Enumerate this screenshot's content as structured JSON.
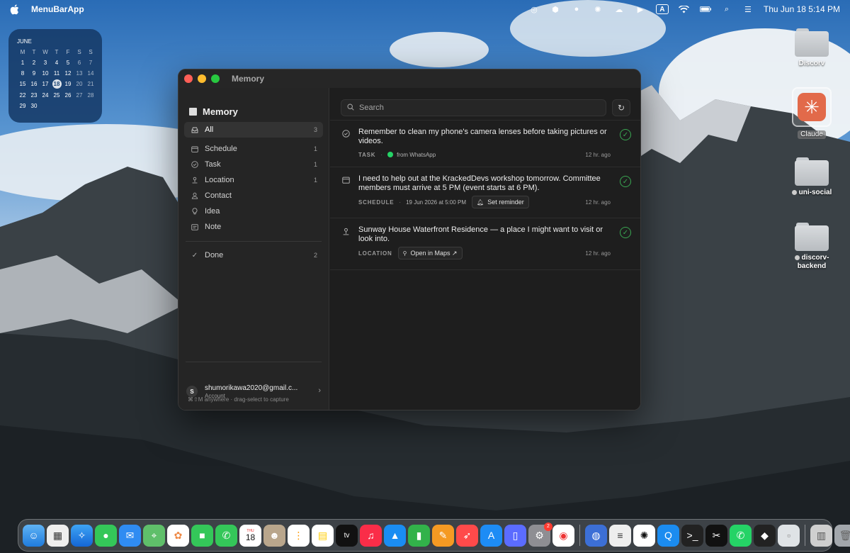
{
  "menubar": {
    "app_name": "MenuBarApp",
    "input_badge": "A",
    "datetime": "Thu Jun 18  5:14 PM"
  },
  "calendar_widget": {
    "month": "JUNE",
    "weekdays": [
      "M",
      "T",
      "W",
      "T",
      "F",
      "S",
      "S"
    ],
    "weeks": [
      [
        "1",
        "2",
        "3",
        "4",
        "5",
        "6",
        "7"
      ],
      [
        "8",
        "9",
        "10",
        "11",
        "12",
        "13",
        "14"
      ],
      [
        "15",
        "16",
        "17",
        "18",
        "19",
        "20",
        "21"
      ],
      [
        "22",
        "23",
        "24",
        "25",
        "26",
        "27",
        "28"
      ],
      [
        "29",
        "30",
        "",
        "",
        "",
        "",
        ""
      ]
    ],
    "today": "18"
  },
  "desktop": {
    "items": [
      {
        "label": "Discorv"
      },
      {
        "label": "Claude"
      },
      {
        "label": "uni-social"
      },
      {
        "label": "discorv-backend"
      }
    ]
  },
  "window": {
    "title": "Memory",
    "sidebar": {
      "heading": "Memory",
      "all": {
        "label": "All",
        "count": "3"
      },
      "items": [
        {
          "label": "Schedule",
          "count": "1",
          "icon": "calendar-icon"
        },
        {
          "label": "Task",
          "count": "1",
          "icon": "check-circle-icon"
        },
        {
          "label": "Location",
          "count": "1",
          "icon": "pin-icon"
        },
        {
          "label": "Contact",
          "count": "",
          "icon": "person-icon"
        },
        {
          "label": "Idea",
          "count": "",
          "icon": "lightbulb-icon"
        },
        {
          "label": "Note",
          "count": "",
          "icon": "note-icon"
        }
      ],
      "done": {
        "label": "Done",
        "count": "2"
      },
      "account": {
        "initial": "S",
        "email": "shumorikawa2020@gmail.c...",
        "sub": "Account"
      },
      "hint": "⌘⇧M anywhere · drag-select to capture"
    },
    "main": {
      "search_placeholder": "Search",
      "memories": [
        {
          "text": "Remember to clean my phone's camera lenses before taking pictures or videos.",
          "type": "TASK",
          "source": "from WhatsApp",
          "ago": "12 hr. ago"
        },
        {
          "text": "I need to help out at the KrackedDevs workshop tomorrow. Committee members must arrive at 5 PM (event starts at 6 PM).",
          "type": "SCHEDULE",
          "date": "19 Jun 2026 at 5:00 PM",
          "action": "Set reminder",
          "ago": "12 hr. ago"
        },
        {
          "text": "Sunway House Waterfront Residence — a place I might want to visit or look into.",
          "type": "LOCATION",
          "action": "Open in Maps ↗",
          "ago": "12 hr. ago"
        }
      ]
    }
  },
  "dock": {
    "calendar_day": "18",
    "calendar_month": "THU",
    "settings_badge": "2",
    "tv_label": "tv"
  },
  "colors": {
    "accent_green": "#3aa552",
    "window_bg": "#1e1e1e",
    "sidebar_bg": "#252525"
  }
}
